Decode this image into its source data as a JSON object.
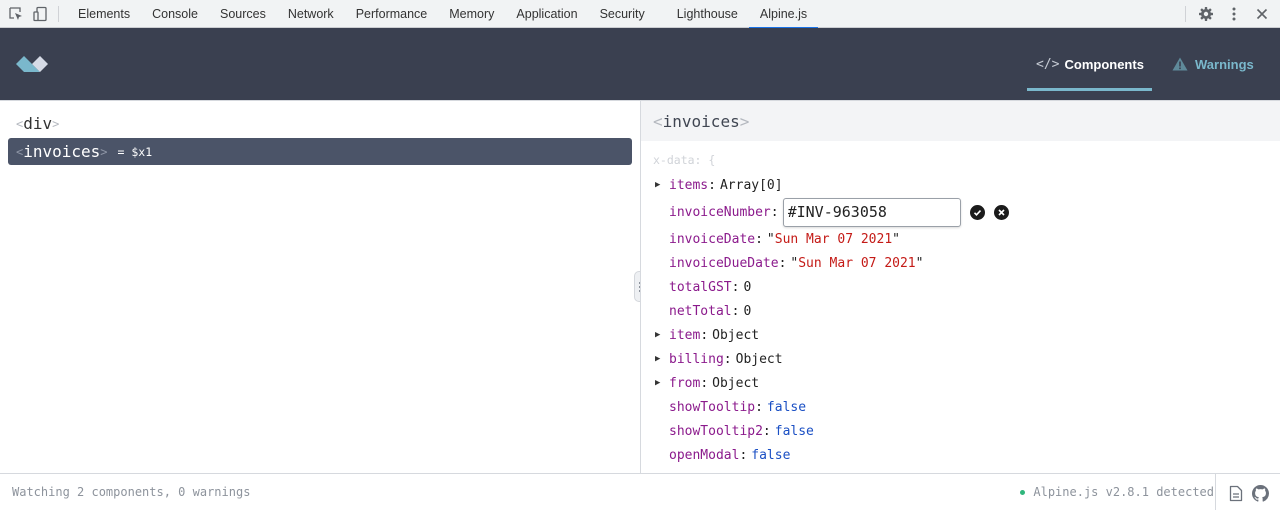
{
  "devtools": {
    "tabs": [
      {
        "label": "Elements"
      },
      {
        "label": "Console"
      },
      {
        "label": "Sources"
      },
      {
        "label": "Network"
      },
      {
        "label": "Performance"
      },
      {
        "label": "Memory"
      },
      {
        "label": "Application"
      },
      {
        "label": "Security"
      },
      {
        "label": "Lighthouse"
      },
      {
        "label": "Alpine.js",
        "active": true
      }
    ],
    "left_icons": [
      "inspect-element-icon",
      "device-toolbar-icon"
    ],
    "right_icons": [
      "gear-icon",
      "more-vertical-icon",
      "close-icon"
    ],
    "accent_color": "#1a73e8"
  },
  "header": {
    "logo": "alpine-logo",
    "nav": {
      "components": {
        "label": "Components",
        "icon": "code-icon",
        "glyph": "</>"
      },
      "warnings": {
        "label": "Warnings",
        "icon": "warning-triangle-icon"
      }
    },
    "background_color": "#3a4050",
    "accent_color": "#7ab8cc"
  },
  "tree": {
    "items": [
      {
        "tag": "div",
        "open": "<",
        "close": ">",
        "selected": false
      },
      {
        "tag": "invoices",
        "open": "<",
        "close": ">",
        "ref": "= $x1",
        "selected": true
      }
    ]
  },
  "detail": {
    "component": {
      "open": "<",
      "tag": "invoices",
      "close": ">"
    },
    "xdata_label": "x-data: {",
    "props": [
      {
        "key": "items",
        "colon": ":",
        "value": "Array[0]",
        "type": "obj",
        "expandable": true
      },
      {
        "key": "invoiceNumber",
        "colon": ":",
        "value": "#INV-963058",
        "type": "editing",
        "expandable": false
      },
      {
        "key": "invoiceDate",
        "colon": ":",
        "value": "Sun Mar 07 2021",
        "type": "string",
        "expandable": false
      },
      {
        "key": "invoiceDueDate",
        "colon": ":",
        "value": "Sun Mar 07 2021",
        "type": "string",
        "expandable": false
      },
      {
        "key": "totalGST",
        "colon": ":",
        "value": "0",
        "type": "number",
        "expandable": false
      },
      {
        "key": "netTotal",
        "colon": ":",
        "value": "0",
        "type": "number",
        "expandable": false
      },
      {
        "key": "item",
        "colon": ":",
        "value": "Object",
        "type": "obj",
        "expandable": true
      },
      {
        "key": "billing",
        "colon": ":",
        "value": "Object",
        "type": "obj",
        "expandable": true
      },
      {
        "key": "from",
        "colon": ":",
        "value": "Object",
        "type": "obj",
        "expandable": true
      },
      {
        "key": "showTooltip",
        "colon": ":",
        "value": "false",
        "type": "bool",
        "expandable": false
      },
      {
        "key": "showTooltip2",
        "colon": ":",
        "value": "false",
        "type": "bool",
        "expandable": false
      },
      {
        "key": "openModal",
        "colon": ":",
        "value": "false",
        "type": "bool",
        "expandable": false
      }
    ],
    "edit": {
      "confirm_icon": "check-circle-icon",
      "cancel_icon": "x-circle-icon"
    },
    "quote": "\""
  },
  "footer": {
    "status": "Watching 2 components, 0 warnings",
    "detected": "Alpine.js v2.8.1 detected",
    "status_dot_color": "#2fb67c",
    "icons": [
      "document-icon",
      "github-icon"
    ]
  }
}
